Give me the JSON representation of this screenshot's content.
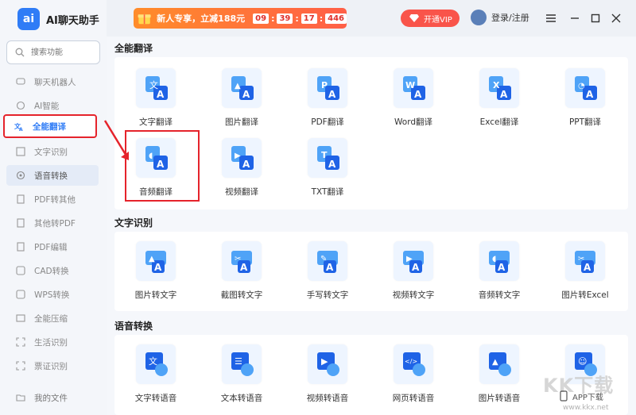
{
  "app": {
    "logo_letter": "ai",
    "title": "AI聊天助手"
  },
  "search": {
    "placeholder": "搜索功能"
  },
  "sidebar": {
    "items": [
      {
        "label": "聊天机器人",
        "icon": "chat-icon"
      },
      {
        "label": "AI智能",
        "icon": "ai-icon"
      },
      {
        "label": "全能翻译",
        "icon": "translate-icon"
      },
      {
        "label": "文字识别",
        "icon": "text-scan-icon"
      },
      {
        "label": "语音转换",
        "icon": "voice-icon"
      },
      {
        "label": "PDF转其他",
        "icon": "pdf-icon"
      },
      {
        "label": "其他转PDF",
        "icon": "to-pdf-icon"
      },
      {
        "label": "PDF编辑",
        "icon": "pdf-edit-icon"
      },
      {
        "label": "CAD转换",
        "icon": "cad-icon"
      },
      {
        "label": "WPS转换",
        "icon": "wps-icon"
      },
      {
        "label": "全能压缩",
        "icon": "compress-icon"
      },
      {
        "label": "生活识别",
        "icon": "life-scan-icon"
      },
      {
        "label": "票证识别",
        "icon": "ticket-icon"
      }
    ],
    "my_files": "我的文件"
  },
  "topbar": {
    "promo_text": "新人专享，立减188元",
    "timer": [
      "09",
      "39",
      "17",
      "446"
    ],
    "vip_label": "开通VIP",
    "login_label": "登录/注册"
  },
  "sections": {
    "translate": {
      "title": "全能翻译",
      "tiles": [
        {
          "label": "文字翻译",
          "glyph": "文"
        },
        {
          "label": "图片翻译",
          "glyph": "▲"
        },
        {
          "label": "PDF翻译",
          "glyph": "P"
        },
        {
          "label": "Word翻译",
          "glyph": "W"
        },
        {
          "label": "Excel翻译",
          "glyph": "X"
        },
        {
          "label": "PPT翻译",
          "glyph": "◔"
        },
        {
          "label": "音频翻译",
          "glyph": "◖"
        },
        {
          "label": "视频翻译",
          "glyph": "▶"
        },
        {
          "label": "TXT翻译",
          "glyph": "T"
        }
      ]
    },
    "ocr": {
      "title": "文字识别",
      "tiles": [
        {
          "label": "图片转文字",
          "glyph": "▲"
        },
        {
          "label": "截图转文字",
          "glyph": "✂"
        },
        {
          "label": "手写转文字",
          "glyph": "✎"
        },
        {
          "label": "视频转文字",
          "glyph": "▶"
        },
        {
          "label": "音频转文字",
          "glyph": "◖"
        },
        {
          "label": "图片转Excel",
          "glyph": "✂"
        }
      ]
    },
    "voice": {
      "title": "语音转换",
      "tiles": [
        {
          "label": "文字转语音",
          "glyph": "文"
        },
        {
          "label": "文本转语音",
          "glyph": "☰"
        },
        {
          "label": "视频转语音",
          "glyph": "▶"
        },
        {
          "label": "网页转语音",
          "glyph": "</>"
        },
        {
          "label": "图片转语音",
          "glyph": "▲"
        },
        {
          "label": "",
          "glyph": "☺"
        }
      ]
    }
  },
  "app_download": "APP下载",
  "watermark": {
    "brand": "KK下载",
    "url": "www.kkx.net"
  },
  "colors": {
    "accent": "#2f7cf6",
    "highlight_red": "#e5232b",
    "promo": "#ff6a3d"
  }
}
